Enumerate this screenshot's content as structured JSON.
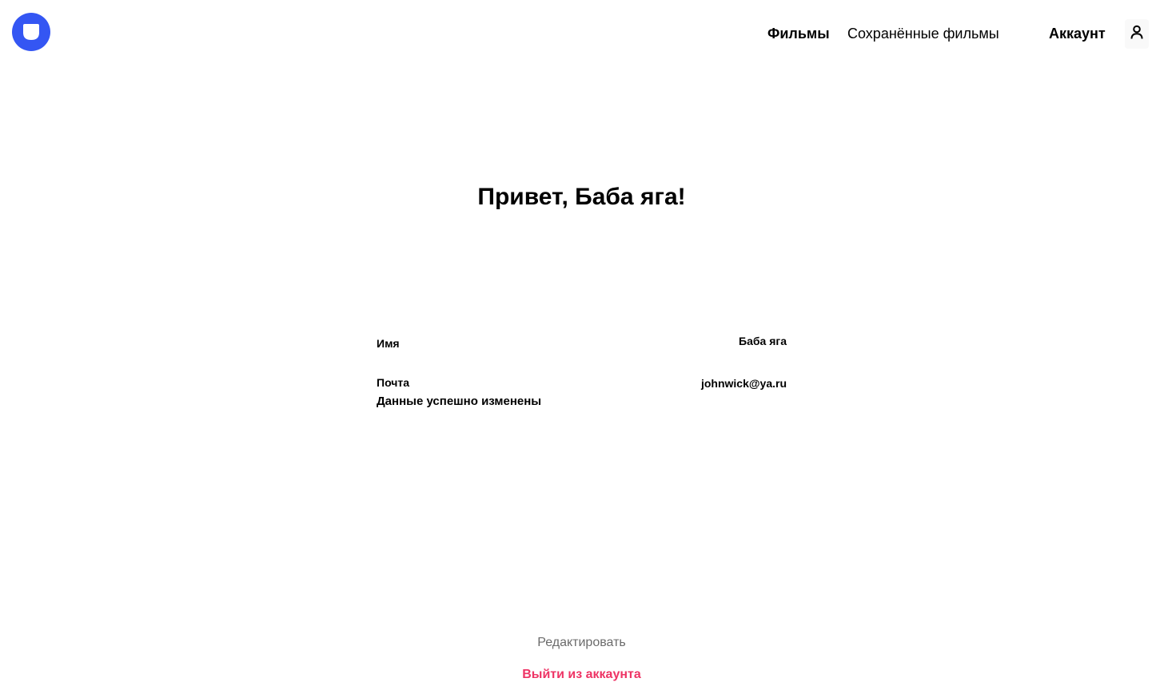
{
  "header": {
    "logo_icon": "logo-icon",
    "nav": {
      "films_label": "Фильмы",
      "saved_label": "Сохранённые фильмы",
      "account_label": "Аккаунт",
      "account_icon": "user-icon"
    }
  },
  "profile": {
    "greeting": "Привет, Баба яга!",
    "name_label": "Имя",
    "name_value": "Баба яга",
    "email_label": "Почта",
    "email_value": "johnwick@ya.ru",
    "success_message": "Данные успешно изменены"
  },
  "actions": {
    "edit_label": "Редактировать",
    "logout_label": "Выйти из аккаунта"
  },
  "colors": {
    "accent": "#3456f3",
    "logout": "#ee3465",
    "muted_text": "#6b6b6b",
    "icon_bg": "#f9f9f9"
  }
}
